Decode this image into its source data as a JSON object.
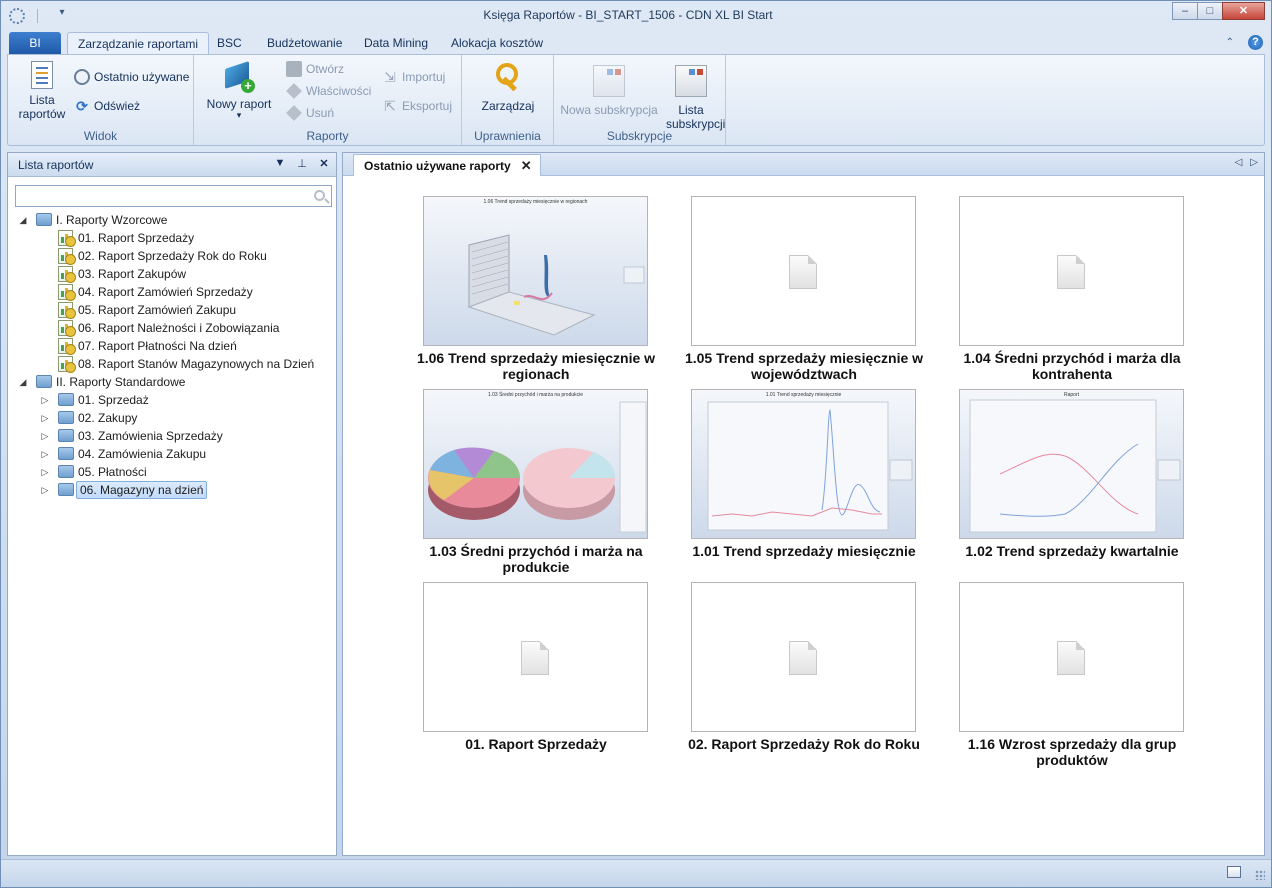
{
  "window": {
    "title": "Księga Raportów - BI_START_1506 - CDN XL BI Start",
    "minimize": "–",
    "maximize": "□",
    "close": "✕"
  },
  "qat": {
    "dropdown_glyph": "▾"
  },
  "ribbon": {
    "app_tab": "BI",
    "tabs": [
      "Zarządzanie raportami",
      "BSC",
      "Budżetowanie",
      "Data Mining",
      "Alokacja kosztów"
    ],
    "collapse_glyph": "⌃",
    "help_glyph": "?",
    "groups": {
      "widok": {
        "label": "Widok",
        "lista_raportow": "Lista raportów",
        "ostatnio_uzywane": "Ostatnio używane",
        "odswiez": "Odśwież"
      },
      "raporty": {
        "label": "Raporty",
        "nowy_raport": "Nowy raport",
        "nowy_raport_arrow": "▾",
        "otworz": "Otwórz",
        "wlasciwosci": "Właściwości",
        "usun": "Usuń",
        "importuj": "Importuj",
        "eksportuj": "Eksportuj"
      },
      "uprawnienia": {
        "label": "Uprawnienia",
        "zarzadzaj": "Zarządzaj"
      },
      "subskrypcje": {
        "label": "Subskrypcje",
        "nowa_subskrypcja": "Nowa subskrypcja",
        "lista_subskrypcji": "Lista subskrypcji"
      }
    }
  },
  "left_panel": {
    "title": "Lista raportów",
    "controls": {
      "dropdown": "▼",
      "pin": "⊥",
      "close": "✕"
    },
    "search": {
      "value": "",
      "placeholder": ""
    },
    "tree": {
      "wzorcowe": {
        "label": "I. Raporty Wzorcowe",
        "arrow": "◢",
        "items": [
          "01. Raport Sprzedaży",
          "02. Raport Sprzedaży Rok do Roku",
          "03. Raport Zakupów",
          "04. Raport Zamówień Sprzedaży",
          "05. Raport Zamówień Zakupu",
          "06. Raport Należności i Zobowiązania",
          "07. Raport Płatności Na dzień",
          "08. Raport Stanów Magazynowych na Dzień"
        ]
      },
      "standardowe": {
        "label": "II. Raporty Standardowe",
        "arrow": "◢",
        "child_arrow": "▷",
        "items": [
          "01. Sprzedaż",
          "02. Zakupy",
          "03. Zamówienia Sprzedaży",
          "04. Zamówienia Zakupu",
          "05. Płatności",
          "06. Magazyny na dzień"
        ]
      }
    }
  },
  "right_panel": {
    "tab_label": "Ostatnio używane raporty",
    "tab_close": "✕",
    "nav": {
      "prev": "◁",
      "next": "▷"
    },
    "cards": [
      {
        "title": "1.06 Trend sprzedaży miesięcznie w regionach",
        "thumb_caption": "1.06 Trend sprzedaży miesięcznie w regionach"
      },
      {
        "title": "1.05 Trend sprzedaży miesięcznie w województwach"
      },
      {
        "title": "1.04 Średni przychód i marża dla kontrahenta"
      },
      {
        "title": "1.03 Średni przychód i marża na produkcie",
        "thumb_caption": "1.03 Średni przychód i marża na produkcie"
      },
      {
        "title": "1.01 Trend sprzedaży miesięcznie",
        "thumb_caption": "1.01 Trend sprzedaży miesięcznie"
      },
      {
        "title": "1.02 Trend sprzedaży kwartalnie",
        "thumb_caption": "Raport"
      },
      {
        "title": "01. Raport Sprzedaży"
      },
      {
        "title": "02. Raport Sprzedaży Rok do Roku"
      },
      {
        "title": "1.16 Wzrost sprzedaży dla grup produktów"
      }
    ]
  }
}
